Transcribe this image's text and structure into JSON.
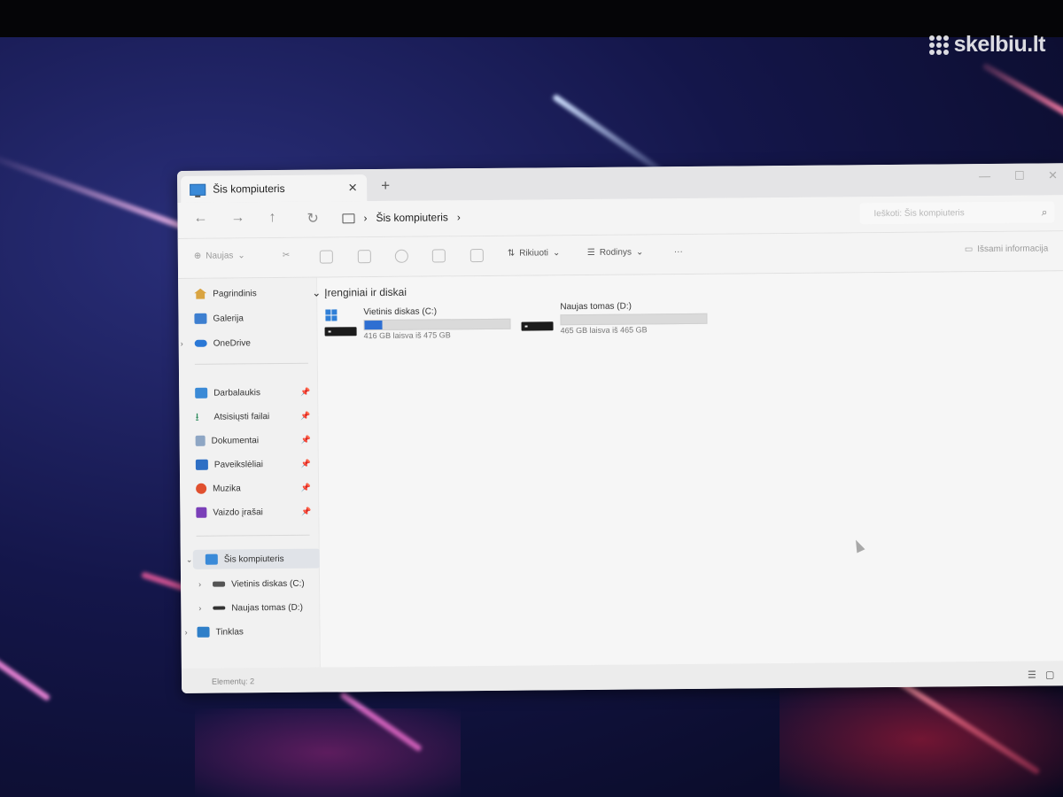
{
  "watermark": {
    "text": "skelbiu.lt"
  },
  "window": {
    "tab": {
      "title": "Šis kompiuteris",
      "icon": "computer-icon",
      "close": "✕",
      "new_tab": "+"
    },
    "controls": {
      "minimize": "—",
      "maximize": "☐",
      "close": "✕"
    },
    "nav": {
      "back": "←",
      "forward": "→",
      "up": "↑",
      "refresh": "↻",
      "breadcrumb": [
        "Šis kompiuteris"
      ],
      "separator": "›",
      "search_placeholder": "Ieškoti: Šis kompiuteris"
    },
    "toolbar": {
      "new_label": "Naujas",
      "sort_label": "Rikiuoti",
      "view_label": "Rodinys",
      "more": "···",
      "details_label": "Išsami informacija"
    },
    "sidebar": {
      "quick": [
        {
          "label": "Pagrindinis",
          "icon": "home-icon"
        },
        {
          "label": "Galerija",
          "icon": "gallery-icon"
        },
        {
          "label": "OneDrive",
          "icon": "cloud-icon"
        }
      ],
      "pinned": [
        {
          "label": "Darbalaukis",
          "icon": "desktop-icon"
        },
        {
          "label": "Atsisiųsti failai",
          "icon": "download-icon"
        },
        {
          "label": "Dokumentai",
          "icon": "documents-icon"
        },
        {
          "label": "Paveikslėliai",
          "icon": "pictures-icon"
        },
        {
          "label": "Muzika",
          "icon": "music-icon"
        },
        {
          "label": "Vaizdo įrašai",
          "icon": "videos-icon"
        }
      ],
      "pin_glyph": "📌",
      "tree": [
        {
          "label": "Šis kompiuteris",
          "icon": "computer-icon",
          "expanded": true,
          "selected": true
        },
        {
          "label": "Vietinis diskas (C:)",
          "icon": "drive-icon"
        },
        {
          "label": "Naujas tomas (D:)",
          "icon": "drive-icon"
        },
        {
          "label": "Tinklas",
          "icon": "network-icon"
        }
      ]
    },
    "content": {
      "group_title": "Įrenginiai ir diskai",
      "drives": [
        {
          "name": "Vietinis diskas (C:)",
          "free_text": "416 GB laisva iš 475 GB",
          "used_fraction": 0.124,
          "has_windows_logo": true
        },
        {
          "name": "Naujas tomas (D:)",
          "free_text": "465 GB laisva iš 465 GB",
          "used_fraction": 0.0,
          "has_windows_logo": false
        }
      ]
    },
    "status": {
      "text": "Elementų: 2"
    }
  },
  "colors": {
    "accent": "#2e6fd2",
    "selection": "#e0e3e8"
  }
}
